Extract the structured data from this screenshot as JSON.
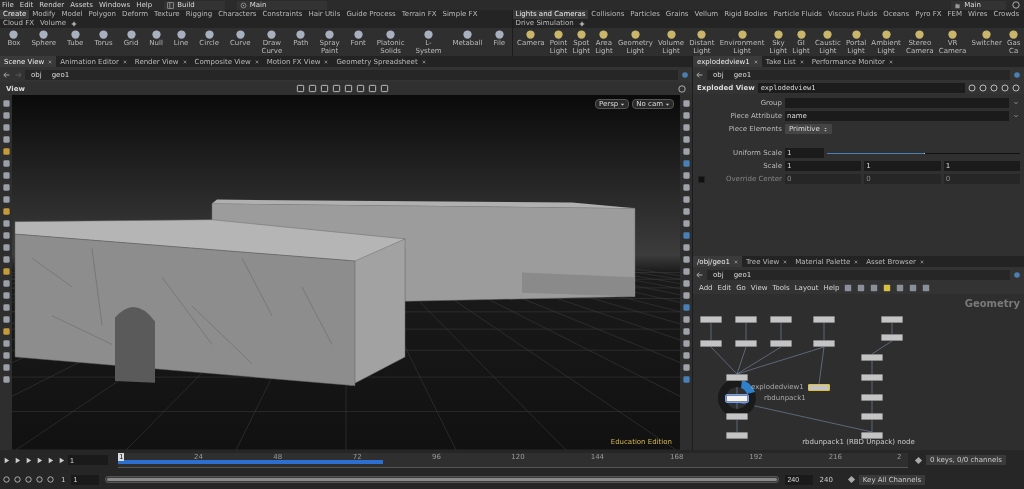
{
  "menu": [
    "File",
    "Edit",
    "Render",
    "Assets",
    "Windows",
    "Help"
  ],
  "desktop_left": "Build",
  "desktop_middle": "Main",
  "desktop_right": "Main",
  "shelf_left": {
    "tabs": [
      {
        "label": "Create",
        "selected": true
      },
      {
        "label": "Modify",
        "selected": false
      },
      {
        "label": "Model",
        "selected": false
      },
      {
        "label": "Polygon",
        "selected": false
      },
      {
        "label": "Deform",
        "selected": false
      },
      {
        "label": "Texture",
        "selected": false
      },
      {
        "label": "Rigging",
        "selected": false
      },
      {
        "label": "Characters",
        "selected": false
      },
      {
        "label": "Constraints",
        "selected": false
      },
      {
        "label": "Hair Utils",
        "selected": false
      },
      {
        "label": "Guide Process",
        "selected": false
      },
      {
        "label": "Terrain FX",
        "selected": false
      },
      {
        "label": "Simple FX",
        "selected": false
      },
      {
        "label": "Cloud FX",
        "selected": false
      },
      {
        "label": "Volume",
        "selected": false
      }
    ],
    "tools": [
      "Box",
      "Sphere",
      "Tube",
      "Torus",
      "Grid",
      "Null",
      "Line",
      "Circle",
      "Curve",
      "Draw Curve",
      "Path",
      "Spray Paint",
      "Font",
      "Platonic Solids",
      "L-System",
      "Metaball",
      "File"
    ]
  },
  "shelf_right": {
    "tabs": [
      {
        "label": "Lights and Cameras",
        "selected": true
      },
      {
        "label": "Collisions",
        "selected": false
      },
      {
        "label": "Particles",
        "selected": false
      },
      {
        "label": "Grains",
        "selected": false
      },
      {
        "label": "Vellum",
        "selected": false
      },
      {
        "label": "Rigid Bodies",
        "selected": false
      },
      {
        "label": "Particle Fluids",
        "selected": false
      },
      {
        "label": "Viscous Fluids",
        "selected": false
      },
      {
        "label": "Oceans",
        "selected": false
      },
      {
        "label": "Pyro FX",
        "selected": false
      },
      {
        "label": "FEM",
        "selected": false
      },
      {
        "label": "Wires",
        "selected": false
      },
      {
        "label": "Crowds",
        "selected": false
      },
      {
        "label": "Drive Simulation",
        "selected": false
      }
    ],
    "tools": [
      "Camera",
      "Point Light",
      "Spot Light",
      "Area Light",
      "Geometry Light",
      "Volume Light",
      "Distant Light",
      "Environment Light",
      "Sky Light",
      "GI Light",
      "Caustic Light",
      "Portal Light",
      "Ambient Light",
      "Stereo Camera",
      "VR Camera",
      "Switcher",
      "Gas Ca"
    ]
  },
  "scene_pane": {
    "tabs": [
      {
        "label": "Scene View",
        "selected": true
      },
      {
        "label": "Animation Editor",
        "selected": false
      },
      {
        "label": "Render View",
        "selected": false
      },
      {
        "label": "Composite View",
        "selected": false
      },
      {
        "label": "Motion FX View",
        "selected": false
      },
      {
        "label": "Geometry Spreadsheet",
        "selected": false
      }
    ],
    "path": [
      "obj",
      "geo1"
    ],
    "title": "View",
    "camera_menus": [
      "Persp",
      "No cam"
    ],
    "edition": "Education Edition"
  },
  "param_pane": {
    "tabs": [
      {
        "label": "explodedview1",
        "selected": true
      },
      {
        "label": "Take List",
        "selected": false
      },
      {
        "label": "Performance Monitor",
        "selected": false
      }
    ],
    "path": [
      "obj",
      "geo1"
    ],
    "node_type": "Exploded View",
    "node_name": "explodedview1",
    "params": [
      {
        "kind": "field",
        "label": "Group"
      },
      {
        "kind": "field",
        "label": "Piece Attribute",
        "value": "name"
      },
      {
        "kind": "menu",
        "label": "Piece Elements",
        "value": "Primitive"
      },
      {
        "kind": "separator"
      },
      {
        "kind": "slider",
        "label": "Uniform Scale",
        "value": "1",
        "level": 0.5
      },
      {
        "kind": "vector",
        "label": "Scale",
        "values": [
          "1",
          "1",
          "1"
        ],
        "disabled": false
      },
      {
        "kind": "vector",
        "label": "Override Center",
        "values": [
          "0",
          "0",
          "0"
        ],
        "disabled": true,
        "checked": false
      }
    ]
  },
  "network_pane": {
    "tabs": [
      {
        "label": "/obj/geo1",
        "selected": true
      },
      {
        "label": "Tree View",
        "selected": false
      },
      {
        "label": "Material Palette",
        "selected": false
      },
      {
        "label": "Asset Browser",
        "selected": false
      }
    ],
    "path": [
      "obj",
      "geo1"
    ],
    "menu": [
      "Add",
      "Edit",
      "Go",
      "View",
      "Tools",
      "Layout",
      "Help"
    ],
    "context": "Geometry",
    "nodes": [
      {
        "selected": false,
        "display": false
      },
      {
        "selected": false,
        "display": false
      },
      {
        "selected": false,
        "display": false
      },
      {
        "selected": false,
        "display": false
      },
      {
        "selected": false,
        "display": false
      },
      {
        "selected": false,
        "display": false
      },
      {
        "selected": false,
        "display": false
      },
      {
        "selected": false,
        "display": false
      },
      {
        "selected": false,
        "display": false
      },
      {
        "selected": false,
        "display": false
      },
      {
        "selected": false,
        "display": false
      },
      {
        "selected": false,
        "display": false
      },
      {
        "label": "explodedview1",
        "selected": false,
        "display": true
      },
      {
        "label": "rbdunpack1",
        "selected": true,
        "display": false
      },
      {
        "selected": false,
        "display": false
      },
      {
        "selected": false,
        "display": false
      },
      {
        "selected": false,
        "display": false
      },
      {
        "selected": false,
        "display": false
      },
      {
        "selected": false,
        "display": false
      },
      {
        "selected": false,
        "display": false
      }
    ],
    "status": "rbdunpack1 (RBD Unpack) node"
  },
  "timeline": {
    "frame": "1",
    "current": "1",
    "ticks": [
      "24",
      "48",
      "72",
      "96",
      "120",
      "144",
      "168",
      "192",
      "216",
      "2"
    ],
    "level": 0.335,
    "keys": "0 keys, 0/0 channels",
    "key_all": "Key All Channels"
  },
  "range": {
    "start": "1",
    "start_field": "1",
    "level": 1,
    "end_field": "240",
    "end": "240"
  }
}
